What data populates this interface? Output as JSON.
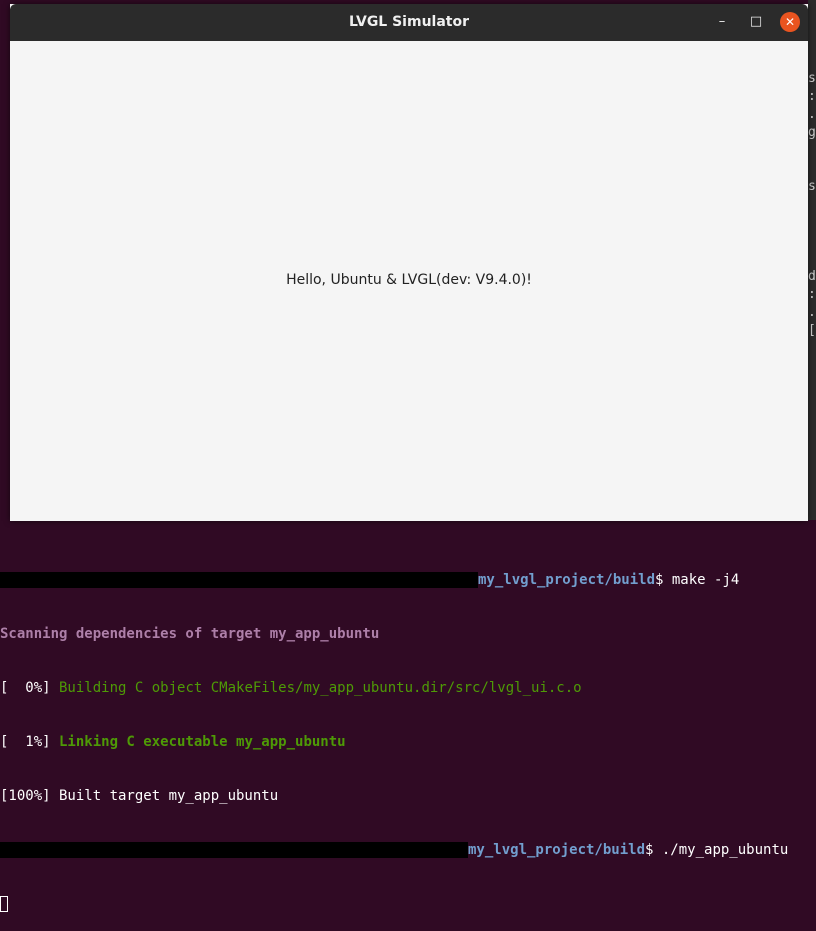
{
  "window": {
    "title": "LVGL Simulator",
    "buttons": {
      "minimize": "–",
      "maximize": "□",
      "close": "✕"
    },
    "accent_color": "#e95420"
  },
  "app": {
    "message": "Hello, Ubuntu & LVGL(dev: V9.4.0)!"
  },
  "terminal": {
    "prompt1_path": "my_lvgl_project/build",
    "prompt1_cmd": "$ make -j4",
    "line_scan": "Scanning dependencies of target my_app_ubuntu",
    "line_build_pct": "[  0%]",
    "line_build_text": " Building C object CMakeFiles/my_app_ubuntu.dir/src/lvgl_ui.c.o",
    "line_link_pct": "[  1%]",
    "line_link_text": " Linking C executable my_app_ubuntu",
    "line_built": "[100%] Built target my_app_ubuntu",
    "prompt2_path": "my_lvgl_project/build",
    "prompt2_cmd": "$ ./my_app_ubuntu"
  },
  "background_terminal": {
    "glyphs": [
      "s",
      ":",
      ".",
      "g",
      "",
      "",
      "s",
      "",
      "",
      "",
      "",
      "d",
      ":",
      ".",
      "["
    ]
  }
}
